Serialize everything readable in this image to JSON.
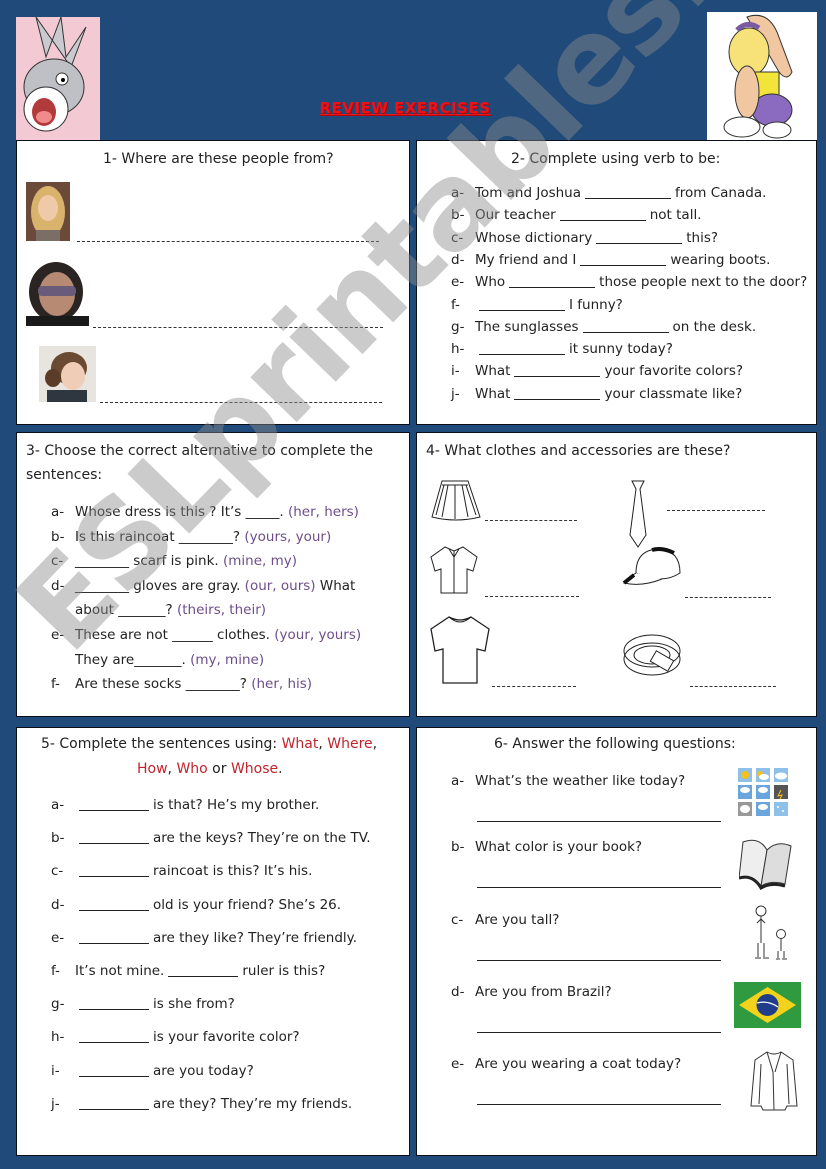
{
  "title": "REVIEW EXERCISES",
  "watermark": "ESLprintables.com",
  "colors": {
    "background": "#1f4a7a",
    "title": "#e8141c",
    "option": "#6e4d8a",
    "keyword": "#c0242c"
  },
  "images": {
    "top_left": "bugs-bunny-cartoon",
    "top_right": "lola-bunny-cartoon"
  },
  "ex1": {
    "heading": "1-  Where are these people from?",
    "people": [
      "person-photo-blonde-woman",
      "person-photo-man-sunglasses",
      "person-photo-brunette-woman"
    ]
  },
  "ex2": {
    "heading": "2- Complete using verb to be:",
    "items": [
      {
        "label": "a-",
        "before": "Tom and Joshua",
        "after": "from Canada."
      },
      {
        "label": "b-",
        "before": "Our teacher",
        "after": "not tall."
      },
      {
        "label": "c-",
        "before": "Whose dictionary",
        "after": "this?"
      },
      {
        "label": "d-",
        "before": "My friend and I",
        "after": "wearing boots."
      },
      {
        "label": "e-",
        "before": "Who",
        "after": "those people next to the door?"
      },
      {
        "label": "f-",
        "before": "",
        "after": "I funny?"
      },
      {
        "label": "g-",
        "before": "The sunglasses",
        "after": "on the desk."
      },
      {
        "label": "h-",
        "before": "",
        "after": "it sunny today?"
      },
      {
        "label": "i-",
        "before": "What",
        "after": "your favorite colors?"
      },
      {
        "label": "j-",
        "before": "What",
        "after": "your classmate like?"
      }
    ]
  },
  "ex3": {
    "heading_line1": "3- Choose the correct alternative to complete the",
    "heading_line2": "sentences:",
    "items": [
      {
        "label": "a-",
        "text": "Whose dress is this ? It’s _____.",
        "opt": "(her, hers)",
        "cont": "",
        "cont_opt": ""
      },
      {
        "label": "b-",
        "text": "Is this raincoat ________?",
        "opt": "(yours, your)",
        "cont": "",
        "cont_opt": ""
      },
      {
        "label": "c-",
        "text": "________ scarf is pink.",
        "opt": "(mine, my)",
        "cont": "",
        "cont_opt": ""
      },
      {
        "label": "d-",
        "text": "________ gloves are gray.",
        "opt": "(our, ours)",
        "tail": "What",
        "cont": "about _______?",
        "cont_opt": "(theirs, their)"
      },
      {
        "label": "e-",
        "text": "These are not ______ clothes.",
        "opt": "(your, yours)",
        "cont": "They are_______.",
        "cont_opt": "(my, mine)"
      },
      {
        "label": "f-",
        "text": "Are these socks ________?",
        "opt": "(her, his)",
        "cont": "",
        "cont_opt": ""
      }
    ]
  },
  "ex4": {
    "heading": "4- What clothes and accessories are these?",
    "items": [
      "skirt-drawing",
      "tie-drawing",
      "shirt-drawing",
      "cap-drawing",
      "t-shirt-drawing",
      "belt-drawing"
    ]
  },
  "ex5": {
    "heading_prefix": "5- Complete the sentences using: ",
    "words": [
      "What",
      "Where",
      "How",
      "Who",
      "Whose"
    ],
    "sep_comma": ", ",
    "sep_or": " or ",
    "period": ".",
    "items": [
      {
        "label": "a-",
        "before": "",
        "after": "is that? He’s my brother."
      },
      {
        "label": "b-",
        "before": "",
        "after": "are the keys? They’re on the TV."
      },
      {
        "label": "c-",
        "before": "",
        "after": "raincoat is this? It’s his."
      },
      {
        "label": "d-",
        "before": "",
        "after": "old is your friend? She’s 26."
      },
      {
        "label": "e-",
        "before": "",
        "after": "are they like? They’re friendly."
      },
      {
        "label": "f-",
        "before": "It’s not mine.",
        "after": "ruler is this?"
      },
      {
        "label": "g-",
        "before": "",
        "after": "is she from?"
      },
      {
        "label": "h-",
        "before": "",
        "after": "is your favorite color?"
      },
      {
        "label": "i-",
        "before": "",
        "after": "are you today?"
      },
      {
        "label": "j-",
        "before": "",
        "after": "are they? They’re my friends."
      }
    ]
  },
  "ex6": {
    "heading": "6- Answer the following questions:",
    "items": [
      {
        "label": "a-",
        "question": "What’s the weather like today?",
        "icon": "weather-icons"
      },
      {
        "label": "b-",
        "question": "What color is your book?",
        "icon": "book-icon"
      },
      {
        "label": "c-",
        "question": "Are you tall?",
        "icon": "tall-short-people-icon"
      },
      {
        "label": "d-",
        "question": "Are you from Brazil?",
        "icon": "brazil-flag-icon"
      },
      {
        "label": "e-",
        "question": "Are you wearing a coat today?",
        "icon": "coat-icon"
      }
    ]
  }
}
